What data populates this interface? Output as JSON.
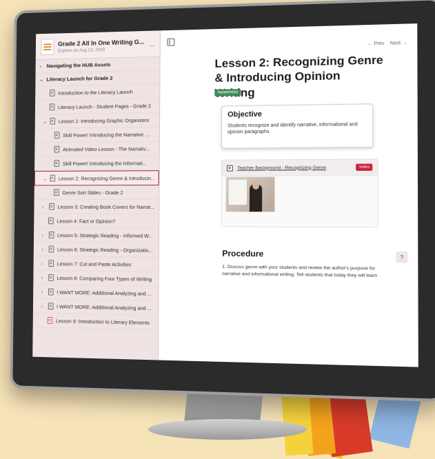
{
  "course": {
    "title": "Grade 2 All In One Writing G...",
    "expires": "Expires on Aug 12, 2030",
    "more": "..."
  },
  "sidebar": {
    "sections": [
      {
        "label": "Navigating the HUB Assets"
      },
      {
        "label": "Literacy Launch for Grade 2"
      }
    ],
    "items": [
      {
        "label": "Introduction to the Literacy Launch"
      },
      {
        "label": "Literacy Launch - Student Pages - Grade 2"
      },
      {
        "label": "Lesson 1: Introducing Graphic Organizers"
      },
      {
        "label": "Skill Power! Introducing the Narrative ..."
      },
      {
        "label": "Animated Video Lesson - The Narrativ..."
      },
      {
        "label": "Skill Power! Introducing the Informati..."
      },
      {
        "label": "Lesson 2: Recognizing Genre & Introducin..."
      },
      {
        "label": "Genre Sort Slides - Grade 2"
      },
      {
        "label": "Lesson 3: Creating Book Covers for Narrat..."
      },
      {
        "label": "Lesson 4: Fact or Opinion?"
      },
      {
        "label": "Lesson 5: Strategic Reading - Informed W..."
      },
      {
        "label": "Lesson 6: Strategic Reading - Organizatio..."
      },
      {
        "label": "Lesson 7: Cut and Paste Activities"
      },
      {
        "label": "Lesson 8: Comparing Four Types of Writing"
      },
      {
        "label": "I WANT MORE: Additional Analyzing and ..."
      },
      {
        "label": "I WANT MORE: Additional Analyzing and ..."
      },
      {
        "label": "Lesson 9: Introduction to Literary Elements"
      }
    ]
  },
  "pager": {
    "prev": "← Prev",
    "next": "Next →"
  },
  "lesson": {
    "title": "Lesson 2: Recognizing Genre & Introducing Opinion Writing",
    "badge": "Awareness",
    "objective_heading": "Objective",
    "objective_text": "Students recognize and identify narrative, informational and opinion paragraphs.",
    "video_title": "Teacher Background - Recognizing Genre",
    "video_tag": "Video",
    "procedure_heading": "Procedure",
    "procedure_text": "1. Discuss genre with your students and review the author's purpose for narrative and informational writing. Tell students that today they will learn"
  },
  "help": "?"
}
